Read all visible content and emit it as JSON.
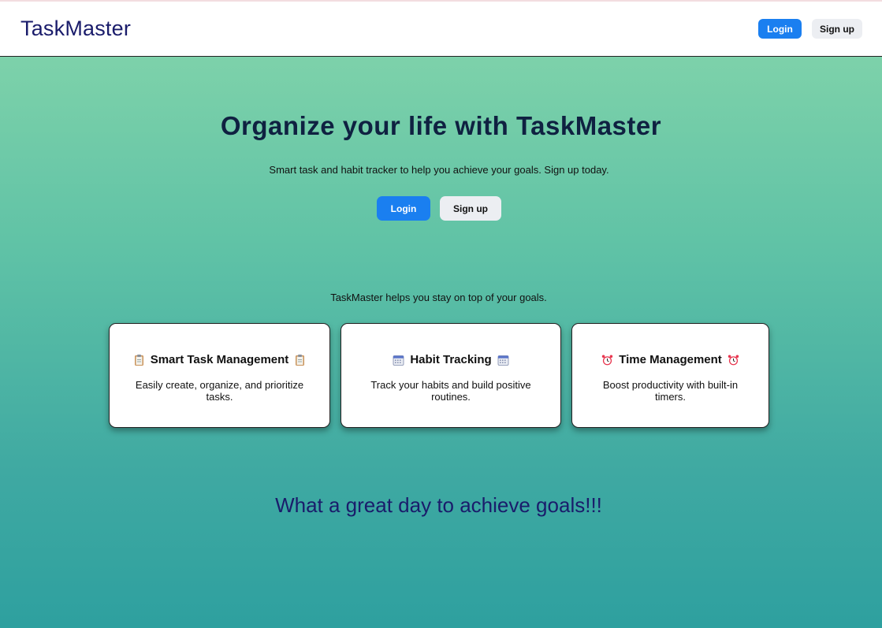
{
  "header": {
    "brand": "TaskMaster",
    "login_label": "Login",
    "signup_label": "Sign up"
  },
  "hero": {
    "title": "Organize your life with TaskMaster",
    "subtitle": "Smart task and habit tracker to help you achieve your goals. Sign up today.",
    "login_label": "Login",
    "signup_label": "Sign up"
  },
  "features": {
    "intro": "TaskMaster helps you stay on top of your goals.",
    "cards": [
      {
        "title": "Smart Task Management",
        "icon": "clipboard-icon",
        "description": "Easily create, organize, and prioritize tasks."
      },
      {
        "title": "Habit Tracking",
        "icon": "calendar-icon",
        "description": "Track your habits and build positive routines."
      },
      {
        "title": "Time Management",
        "icon": "alarm-clock-icon",
        "description": "Boost productivity with built-in timers."
      }
    ]
  },
  "tagline": "What a great day to achieve goals!!!",
  "colors": {
    "brand_text": "#1a1c6b",
    "primary_button": "#1a7ff0",
    "secondary_button": "#eceef2",
    "gradient_top": "#86d6ab",
    "gradient_bottom": "#2ea09f"
  }
}
